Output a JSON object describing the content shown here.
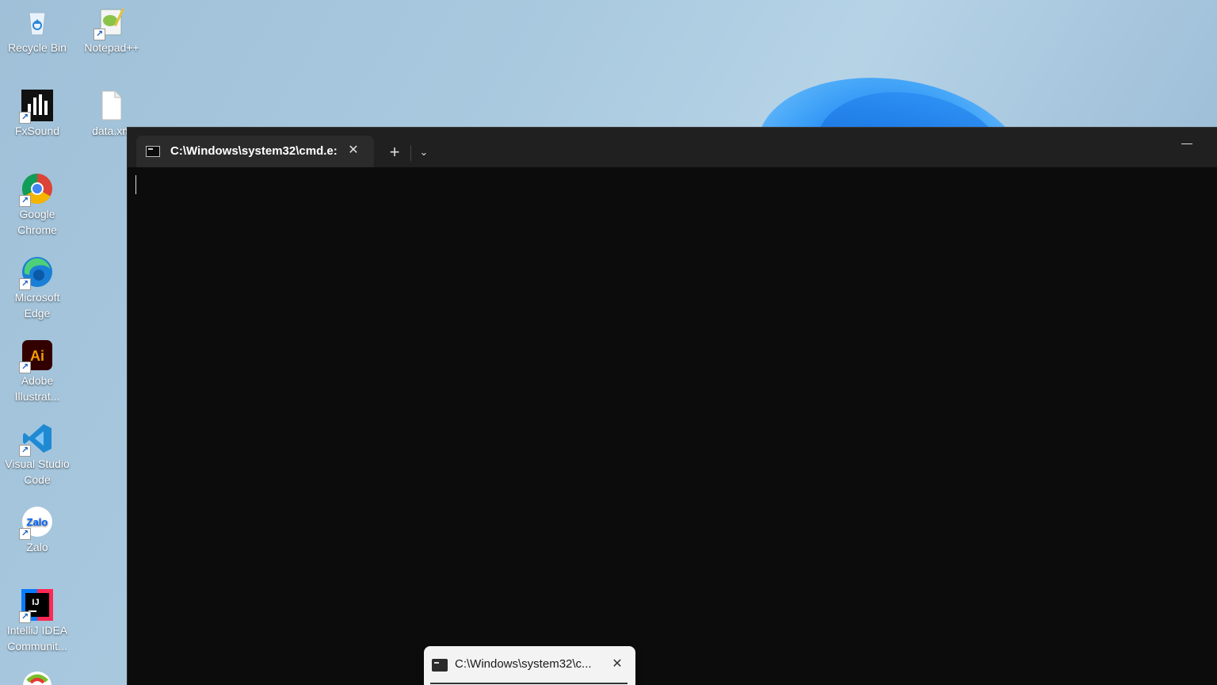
{
  "desktop": {
    "icons": [
      {
        "label": "Recycle Bin"
      },
      {
        "label": "Notepad++"
      },
      {
        "label": "FxSound"
      },
      {
        "label": "data.xm"
      },
      {
        "label": "Google Chrome"
      },
      {
        "label": "Microsoft Edge"
      },
      {
        "label": "Adobe Illustrat..."
      },
      {
        "label": "Visual Studio Code"
      },
      {
        "label": "Zalo"
      },
      {
        "label": "IntelliJ IDEA Communit..."
      }
    ]
  },
  "terminal": {
    "tab_title": "C:\\Windows\\system32\\cmd.e:",
    "tab_close_glyph": "✕",
    "new_tab_glyph": "+",
    "dropdown_glyph": "⌄"
  },
  "taskbar_preview": {
    "title": "C:\\Windows\\system32\\c...",
    "close_glyph": "✕"
  },
  "colors": {
    "terminal_bg": "#0c0c0c",
    "titlebar_bg": "#202020",
    "tab_bg": "#2b2b2b",
    "accent": "#1d84ef"
  }
}
